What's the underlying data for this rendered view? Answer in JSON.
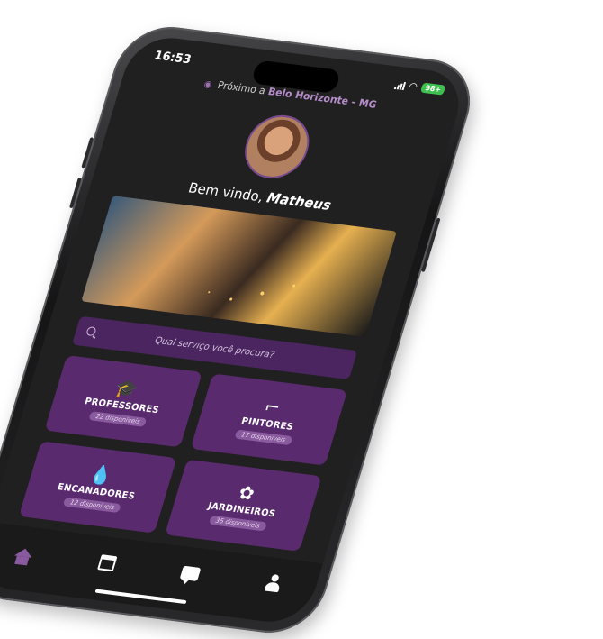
{
  "status_bar": {
    "time": "16:53",
    "battery": "98+"
  },
  "location": {
    "prefix": "Próximo a",
    "city": "Belo Horizonte - MG"
  },
  "welcome": {
    "greeting": "Bem vindo,",
    "name": "Matheus"
  },
  "search": {
    "placeholder": "Qual serviço você procura?"
  },
  "services": [
    {
      "title": "PROFESSORES",
      "count": "22 disponíveis",
      "icon": "graduation-cap-icon"
    },
    {
      "title": "PINTORES",
      "count": "17 disponíveis",
      "icon": "paint-roller-icon"
    },
    {
      "title": "ENCANADORES",
      "count": "12 disponíveis",
      "icon": "water-drop-icon"
    },
    {
      "title": "JARDINEIROS",
      "count": "35 disponíveis",
      "icon": "flower-icon"
    }
  ],
  "nav": [
    "home-icon",
    "calendar-icon",
    "chat-icon",
    "user-icon"
  ],
  "colors": {
    "accent": "#5a2a6e",
    "search_bg": "#4a2560",
    "screen_bg": "#202021",
    "battery": "#3fbf4f"
  }
}
